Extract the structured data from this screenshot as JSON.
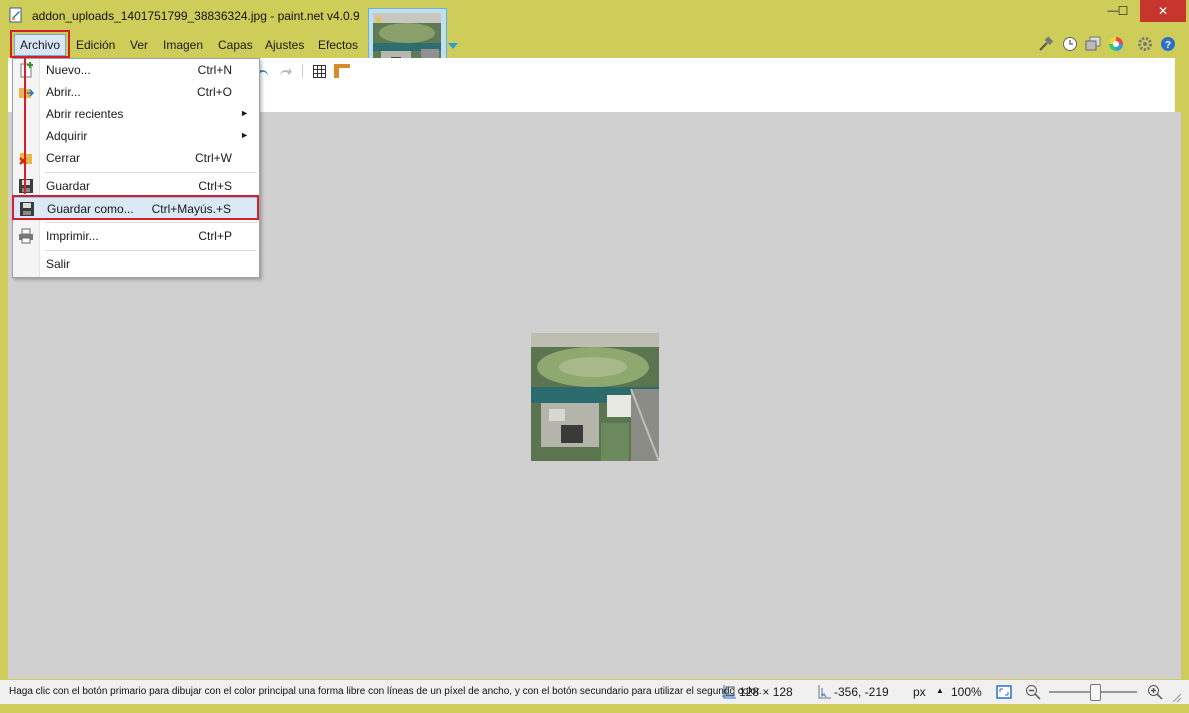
{
  "window": {
    "title": "addon_uploads_1401751799_38836324.jpg - paint.net v4.0.9",
    "minimize_glyph": "—",
    "maximize_glyph": "☐",
    "close_glyph": "✕"
  },
  "menubar": {
    "items": [
      "Archivo",
      "Edición",
      "Ver",
      "Imagen",
      "Capas",
      "Ajustes",
      "Efectos"
    ]
  },
  "right_tools": [
    "tools-icon",
    "history-icon",
    "layers-icon",
    "colors-icon",
    "settings-icon",
    "help-icon"
  ],
  "file_menu": {
    "items": [
      {
        "label": "Nuevo...",
        "shortcut": "Ctrl+N",
        "icon": "new-file-icon"
      },
      {
        "label": "Abrir...",
        "shortcut": "Ctrl+O",
        "icon": "open-folder-icon"
      },
      {
        "label": "Abrir recientes",
        "shortcut": "",
        "submenu": "►"
      },
      {
        "label": "Adquirir",
        "shortcut": "",
        "submenu": "►"
      },
      {
        "label": "Cerrar",
        "shortcut": "Ctrl+W",
        "icon": "close-file-icon"
      },
      {
        "label": "Guardar",
        "shortcut": "Ctrl+S",
        "icon": "save-icon"
      },
      {
        "label": "Guardar como...",
        "shortcut": "Ctrl+Mayús.+S",
        "icon": "save-as-icon"
      },
      {
        "label": "Imprimir...",
        "shortcut": "Ctrl+P",
        "icon": "print-icon"
      },
      {
        "label": "Salir",
        "shortcut": ""
      }
    ]
  },
  "statusbar": {
    "message": "Haga clic con el botón primario para dibujar con el color principal una forma libre con líneas de un píxel de ancho, y con el botón secundario para utilizar el segundo color.",
    "image_size": "128 × 128",
    "cursor_position": "-356, -219",
    "units": "px",
    "zoom": "100%"
  },
  "colors": {
    "title_bar": "#cfcd5a",
    "close_button": "#c7362c",
    "highlight_box": "#d4202a",
    "workspace": "#d0d0d0"
  }
}
